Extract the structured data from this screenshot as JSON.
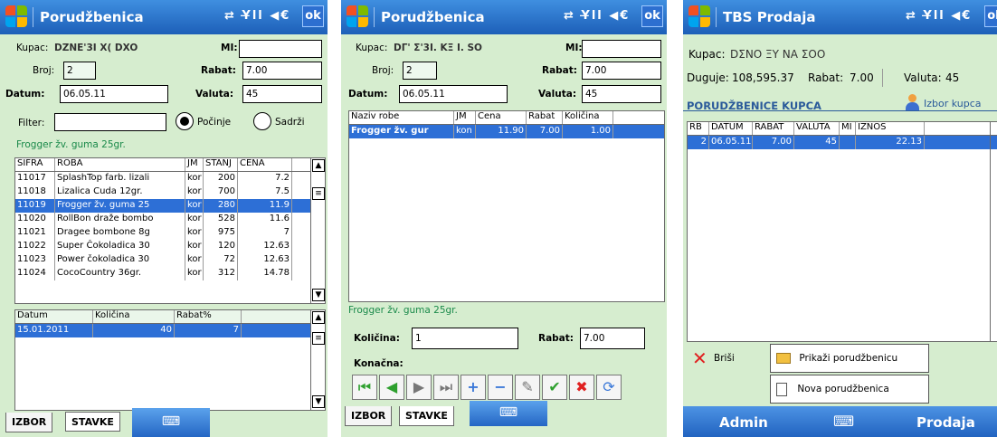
{
  "status_icons": "⇄ Y̶ll ◀€",
  "ok": "ok",
  "screen1": {
    "title": "Porudžbenica",
    "kupac_label": "Kupac:",
    "kupac_value": "DZNE'3I X( DXO",
    "mi_label": "MI:",
    "mi_value": "",
    "broj_label": "Broj:",
    "broj_value": "2",
    "rabat_label": "Rabat:",
    "rabat_value": "7.00",
    "datum_label": "Datum:",
    "datum_value": "06.05.11",
    "valuta_label": "Valuta:",
    "valuta_value": "45",
    "filter_label": "Filter:",
    "filter_value": "",
    "radio_pocinje": "Počinje",
    "radio_sadrzi": "Sadrži",
    "selected_item_text": "Frogger žv. guma 25gr.",
    "products_headers": [
      "ŠIFRA",
      "ROBA",
      "JM",
      "STANJ",
      "CENA"
    ],
    "products": [
      {
        "sifra": "11017",
        "roba": "SplashTop farb. lizali",
        "jm": "kor",
        "stanje": "200",
        "cena": "7.2",
        "sel": false
      },
      {
        "sifra": "11018",
        "roba": "Lizalica Cuda 12gr.",
        "jm": "kor",
        "stanje": "700",
        "cena": "7.5",
        "sel": false
      },
      {
        "sifra": "11019",
        "roba": "Frogger žv. guma 25",
        "jm": "kor",
        "stanje": "280",
        "cena": "11.9",
        "sel": true
      },
      {
        "sifra": "11020",
        "roba": "RollBon draže bombo",
        "jm": "kor",
        "stanje": "528",
        "cena": "11.6",
        "sel": false
      },
      {
        "sifra": "11021",
        "roba": "Dragee bombone 8g",
        "jm": "kor",
        "stanje": "975",
        "cena": "7",
        "sel": false
      },
      {
        "sifra": "11022",
        "roba": "Super Čokoladica 30",
        "jm": "kor",
        "stanje": "120",
        "cena": "12.63",
        "sel": false
      },
      {
        "sifra": "11023",
        "roba": "Power čokoladica 30",
        "jm": "kor",
        "stanje": "72",
        "cena": "12.63",
        "sel": false
      },
      {
        "sifra": "11024",
        "roba": "CocoCountry 36gr.",
        "jm": "kor",
        "stanje": "312",
        "cena": "14.78",
        "sel": false
      }
    ],
    "history_headers": [
      "Datum",
      "Količina",
      "Rabat%"
    ],
    "history": [
      {
        "datum": "15.01.2011",
        "kolicina": "40",
        "rabat": "7"
      }
    ],
    "tab_izbor": "IZBOR",
    "tab_stavke": "STAVKE"
  },
  "screen2": {
    "title": "Porudžbenica",
    "kupac_label": "Kupac:",
    "kupac_value": "DΓ' Σ'3Ι. ΚΞ Ι. SO",
    "mi_label": "MI:",
    "mi_value": "",
    "broj_label": "Broj:",
    "broj_value": "2",
    "rabat_label": "Rabat:",
    "rabat_value": "7.00",
    "datum_label": "Datum:",
    "datum_value": "06.05.11",
    "valuta_label": "Valuta:",
    "valuta_value": "45",
    "items_headers": [
      "Naziv robe",
      "JM",
      "Cena",
      "Rabat",
      "Količina"
    ],
    "items": [
      {
        "naziv": "Frogger žv. gur",
        "jm": "kon",
        "cena": "11.90",
        "rabat": "7.00",
        "kolicina": "1.00"
      }
    ],
    "selected_item_text": "Frogger žv. guma 25gr.",
    "kolicina_label": "Količina:",
    "kolicina_value": "1",
    "rabat2_label": "Rabat:",
    "rabat2_value": "7.00",
    "konacna_label": "Konačna:",
    "tab_izbor": "IZBOR",
    "tab_stavke": "STAVKE"
  },
  "screen3": {
    "title": "TBS Prodaja",
    "kupac_label": "Kupac:",
    "kupac_value": "DΣNO ΞΥ ΝΑ ΣΟΟ",
    "duguje_label": "Duguje:",
    "duguje_value": "108,595.37",
    "rabat_label": "Rabat:",
    "rabat_value": "7.00",
    "valuta_label": "Valuta:",
    "valuta_value": "45",
    "section_title": "PORUDŽBENICE KUPCA",
    "izbor_kupca": "Izbor kupca",
    "orders_headers": [
      "RB",
      "DATUM",
      "RABAT",
      "VALUTA",
      "MI",
      "IZNOS"
    ],
    "orders": [
      {
        "rb": "2",
        "datum": "06.05.11",
        "rabat": "7.00",
        "valuta": "45",
        "mi": "",
        "iznos": "22.13"
      }
    ],
    "brisi": "Briši",
    "prikazi": "Prikaži porudžbenicu",
    "nova": "Nova porudžbenica",
    "admin": "Admin",
    "prodaja": "Prodaja"
  }
}
